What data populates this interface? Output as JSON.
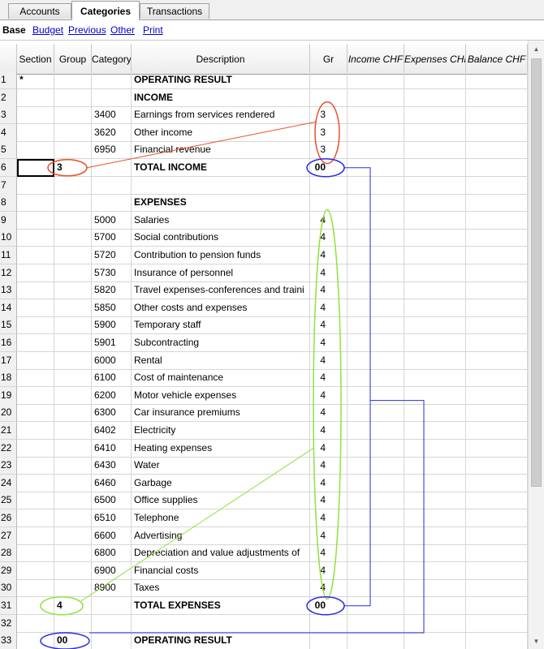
{
  "tabs": [
    "Accounts",
    "Categories",
    "Transactions"
  ],
  "active_tab": "Categories",
  "subnav": {
    "current": "Base",
    "links": [
      "Budget",
      "Previous",
      "Other",
      "Print"
    ]
  },
  "columns": [
    "Section",
    "Group",
    "Category",
    "Description",
    "Gr",
    "Income CHF",
    "Expenses CHF",
    "Balance CHF"
  ],
  "rows": [
    {
      "n": "1",
      "section": "*",
      "group": "",
      "category": "",
      "description": "OPERATING RESULT",
      "gr": "",
      "bold": true
    },
    {
      "n": "2",
      "section": "",
      "group": "",
      "category": "",
      "description": "INCOME",
      "gr": "",
      "bold": true
    },
    {
      "n": "3",
      "section": "",
      "group": "",
      "category": "3400",
      "description": "Earnings from services rendered",
      "gr": "3",
      "bold": false
    },
    {
      "n": "4",
      "section": "",
      "group": "",
      "category": "3620",
      "description": "Other income",
      "gr": "3",
      "bold": false
    },
    {
      "n": "5",
      "section": "",
      "group": "",
      "category": "6950",
      "description": "Financial revenue",
      "gr": "3",
      "bold": false
    },
    {
      "n": "6",
      "section": "",
      "group": "3",
      "category": "",
      "description": "TOTAL INCOME",
      "gr": "00",
      "bold": true
    },
    {
      "n": "7",
      "section": "",
      "group": "",
      "category": "",
      "description": "",
      "gr": "",
      "bold": false
    },
    {
      "n": "8",
      "section": "",
      "group": "",
      "category": "",
      "description": "EXPENSES",
      "gr": "",
      "bold": true
    },
    {
      "n": "9",
      "section": "",
      "group": "",
      "category": "5000",
      "description": "Salaries",
      "gr": "4",
      "bold": false
    },
    {
      "n": "10",
      "section": "",
      "group": "",
      "category": "5700",
      "description": "Social contributions",
      "gr": "4",
      "bold": false
    },
    {
      "n": "11",
      "section": "",
      "group": "",
      "category": "5720",
      "description": "Contribution to pension funds",
      "gr": "4",
      "bold": false
    },
    {
      "n": "12",
      "section": "",
      "group": "",
      "category": "5730",
      "description": "Insurance of personnel",
      "gr": "4",
      "bold": false
    },
    {
      "n": "13",
      "section": "",
      "group": "",
      "category": "5820",
      "description": "Travel expenses-conferences and traini",
      "gr": "4",
      "bold": false
    },
    {
      "n": "14",
      "section": "",
      "group": "",
      "category": "5850",
      "description": "Other costs and expenses",
      "gr": "4",
      "bold": false
    },
    {
      "n": "15",
      "section": "",
      "group": "",
      "category": "5900",
      "description": "Temporary staff",
      "gr": "4",
      "bold": false
    },
    {
      "n": "16",
      "section": "",
      "group": "",
      "category": "5901",
      "description": "Subcontracting",
      "gr": "4",
      "bold": false
    },
    {
      "n": "17",
      "section": "",
      "group": "",
      "category": "6000",
      "description": "Rental",
      "gr": "4",
      "bold": false
    },
    {
      "n": "18",
      "section": "",
      "group": "",
      "category": "6100",
      "description": "Cost of maintenance",
      "gr": "4",
      "bold": false
    },
    {
      "n": "19",
      "section": "",
      "group": "",
      "category": "6200",
      "description": "Motor vehicle expenses",
      "gr": "4",
      "bold": false
    },
    {
      "n": "20",
      "section": "",
      "group": "",
      "category": "6300",
      "description": "Car insurance premiums",
      "gr": "4",
      "bold": false
    },
    {
      "n": "21",
      "section": "",
      "group": "",
      "category": "6402",
      "description": "Electricity",
      "gr": "4",
      "bold": false
    },
    {
      "n": "22",
      "section": "",
      "group": "",
      "category": "6410",
      "description": "Heating expenses",
      "gr": "4",
      "bold": false
    },
    {
      "n": "23",
      "section": "",
      "group": "",
      "category": "6430",
      "description": "Water",
      "gr": "4",
      "bold": false
    },
    {
      "n": "24",
      "section": "",
      "group": "",
      "category": "6460",
      "description": "Garbage",
      "gr": "4",
      "bold": false
    },
    {
      "n": "25",
      "section": "",
      "group": "",
      "category": "6500",
      "description": "Office supplies",
      "gr": "4",
      "bold": false
    },
    {
      "n": "26",
      "section": "",
      "group": "",
      "category": "6510",
      "description": "Telephone",
      "gr": "4",
      "bold": false
    },
    {
      "n": "27",
      "section": "",
      "group": "",
      "category": "6600",
      "description": "Advertising",
      "gr": "4",
      "bold": false
    },
    {
      "n": "28",
      "section": "",
      "group": "",
      "category": "6800",
      "description": "Depreciation and value adjustments of",
      "gr": "4",
      "bold": false
    },
    {
      "n": "29",
      "section": "",
      "group": "",
      "category": "6900",
      "description": "Financial costs",
      "gr": "4",
      "bold": false
    },
    {
      "n": "30",
      "section": "",
      "group": "",
      "category": "8900",
      "description": "Taxes",
      "gr": "4",
      "bold": false
    },
    {
      "n": "31",
      "section": "",
      "group": "4",
      "category": "",
      "description": "TOTAL EXPENSES",
      "gr": "00",
      "bold": true
    },
    {
      "n": "32",
      "section": "",
      "group": "",
      "category": "",
      "description": "",
      "gr": "",
      "bold": false
    },
    {
      "n": "33",
      "section": "",
      "group": "00",
      "category": "",
      "description": "OPERATING RESULT",
      "gr": "",
      "bold": true
    }
  ],
  "annotation_colors": {
    "income_group": "#e8502a",
    "expense_group": "#8fe23c",
    "result_group": "#2a2ae0"
  }
}
